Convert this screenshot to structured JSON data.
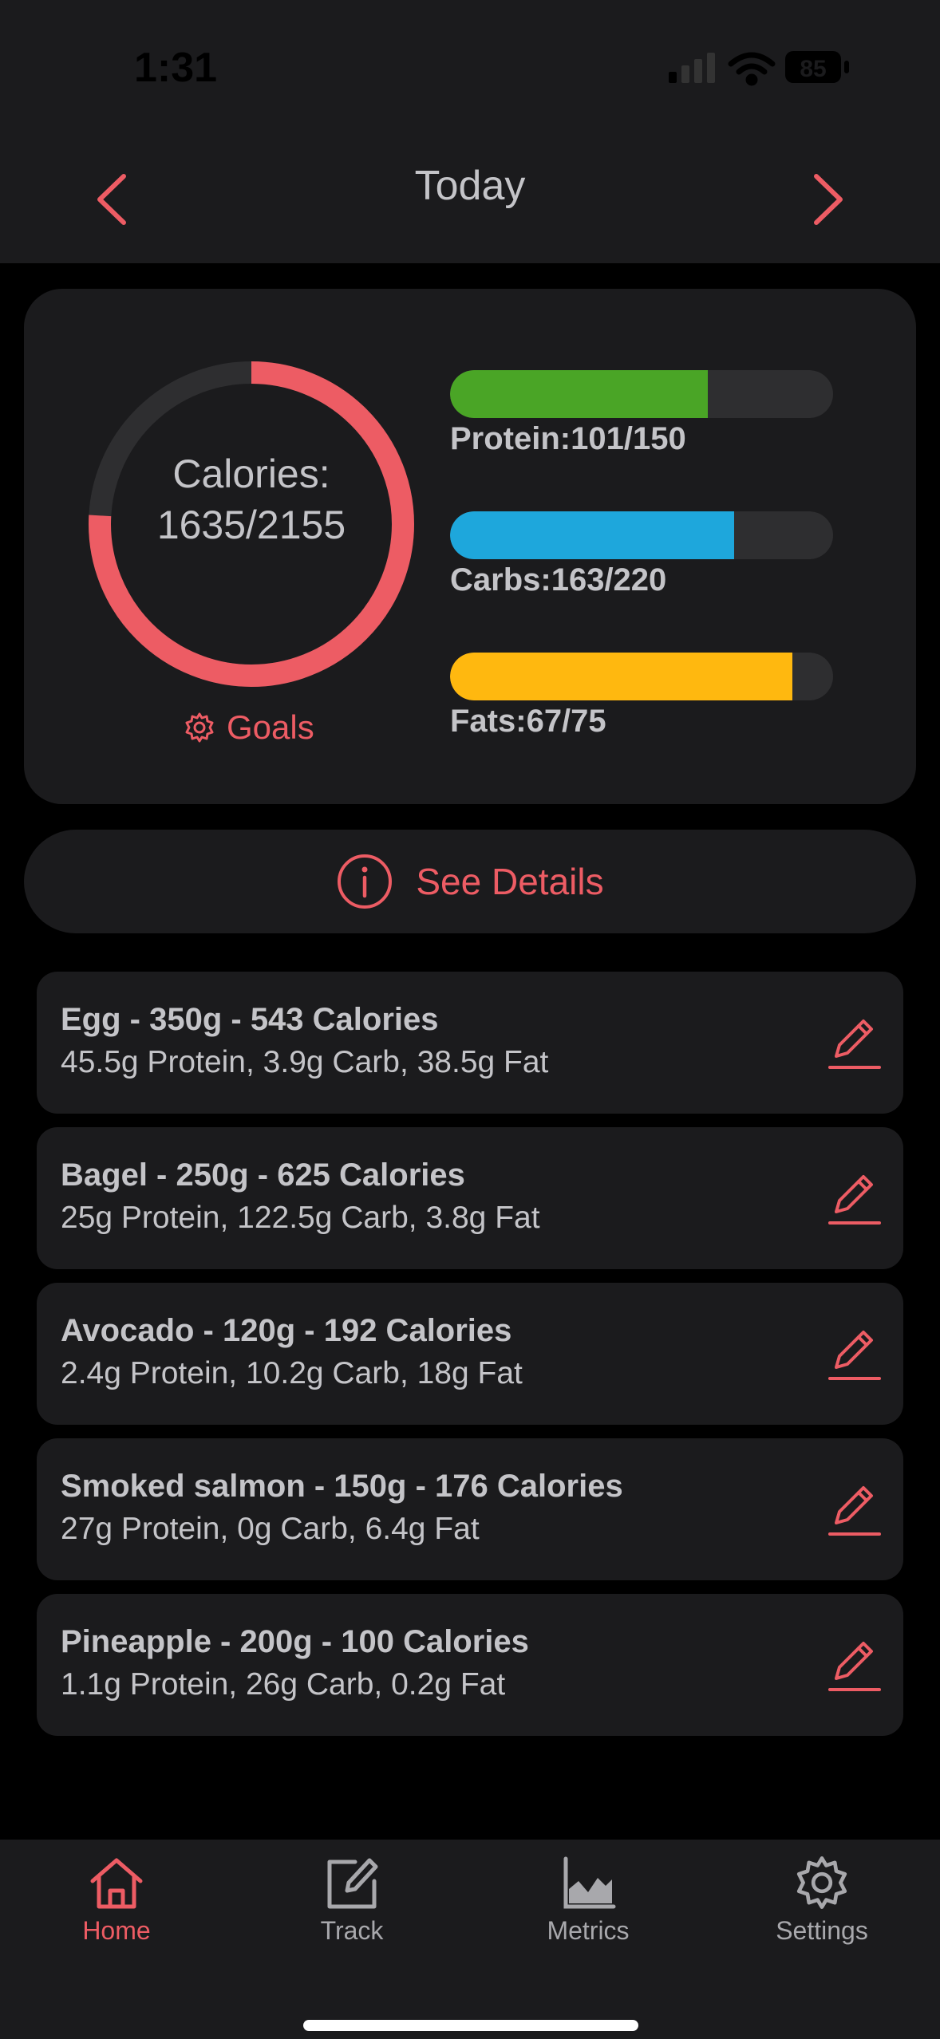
{
  "status_bar": {
    "time": "1:31",
    "battery": "85"
  },
  "header": {
    "title": "Today",
    "prev_icon": "chevron-left-icon",
    "next_icon": "chevron-right-icon"
  },
  "summary": {
    "calories_label": "Calories:",
    "calories_value": "1635/2155",
    "calories_consumed": 1635,
    "calories_goal": 2155,
    "goals_label": "Goals",
    "macros": [
      {
        "label": "Protein:101/150",
        "consumed": 101,
        "goal": 150,
        "color": "#4aa526"
      },
      {
        "label": "Carbs:163/220",
        "consumed": 163,
        "goal": 220,
        "color": "#1ea7dc"
      },
      {
        "label": "Fats:67/75",
        "consumed": 67,
        "goal": 75,
        "color": "#ffb80f"
      }
    ],
    "ring_color": "#ed5c64",
    "ring_track_color": "#2e2e30"
  },
  "details_button": {
    "label": "See Details"
  },
  "foods": [
    {
      "title": "Egg - 350g - 543 Calories",
      "subtitle": "45.5g Protein, 3.9g Carb, 38.5g Fat"
    },
    {
      "title": "Bagel - 250g - 625 Calories",
      "subtitle": "25g Protein, 122.5g Carb, 3.8g Fat"
    },
    {
      "title": "Avocado - 120g - 192 Calories",
      "subtitle": "2.4g Protein, 10.2g Carb, 18g Fat"
    },
    {
      "title": "Smoked salmon - 150g - 176 Calories",
      "subtitle": "27g Protein, 0g Carb, 6.4g Fat"
    },
    {
      "title": "Pineapple - 200g - 100 Calories",
      "subtitle": "1.1g Protein, 26g Carb, 0.2g Fat"
    }
  ],
  "tabs": [
    {
      "label": "Home",
      "icon": "home-icon",
      "active": true
    },
    {
      "label": "Track",
      "icon": "track-icon",
      "active": false
    },
    {
      "label": "Metrics",
      "icon": "metrics-icon",
      "active": false
    },
    {
      "label": "Settings",
      "icon": "settings-icon",
      "active": false
    }
  ],
  "accent_color": "#ed5c64"
}
